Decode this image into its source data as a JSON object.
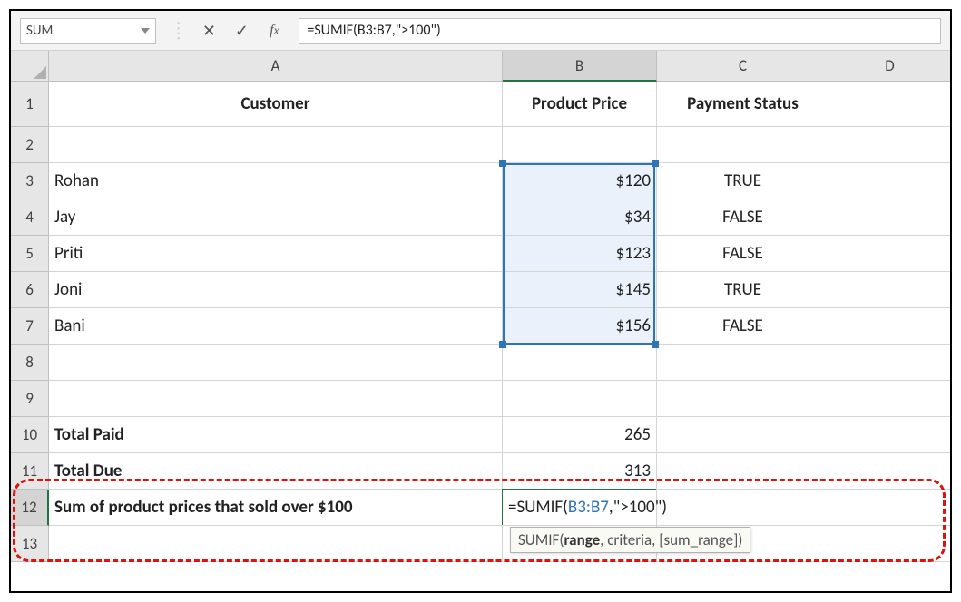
{
  "nameBox": "SUM",
  "formulaBar": "=SUMIF(B3:B7,\">100\")",
  "columns": [
    "A",
    "B",
    "C",
    "D"
  ],
  "rowNumbers": [
    "1",
    "2",
    "3",
    "4",
    "5",
    "6",
    "7",
    "8",
    "9",
    "10",
    "11",
    "12",
    "13"
  ],
  "headers": {
    "A": "Customer",
    "B": "Product Price",
    "C": "Payment Status"
  },
  "dataRows": [
    {
      "customer": "Rohan",
      "price": "$120",
      "status": "TRUE"
    },
    {
      "customer": "Jay",
      "price": "$34",
      "status": "FALSE"
    },
    {
      "customer": "Priti",
      "price": "$123",
      "status": "FALSE"
    },
    {
      "customer": "Joni",
      "price": "$145",
      "status": "TRUE"
    },
    {
      "customer": "Bani",
      "price": "$156",
      "status": "FALSE"
    }
  ],
  "totals": {
    "paidLabel": "Total Paid",
    "paidValue": "265",
    "dueLabel": "Total Due",
    "dueValue": "313"
  },
  "row12": {
    "label": "Sum of product prices that sold over $100",
    "formulaPrefix": "=SUMIF(",
    "formulaRange": "B3:B7",
    "formulaSuffix": ",\">100\")"
  },
  "tooltip": {
    "fn": "SUMIF",
    "arg1": "range",
    "rest": ", criteria, [sum_range])"
  }
}
